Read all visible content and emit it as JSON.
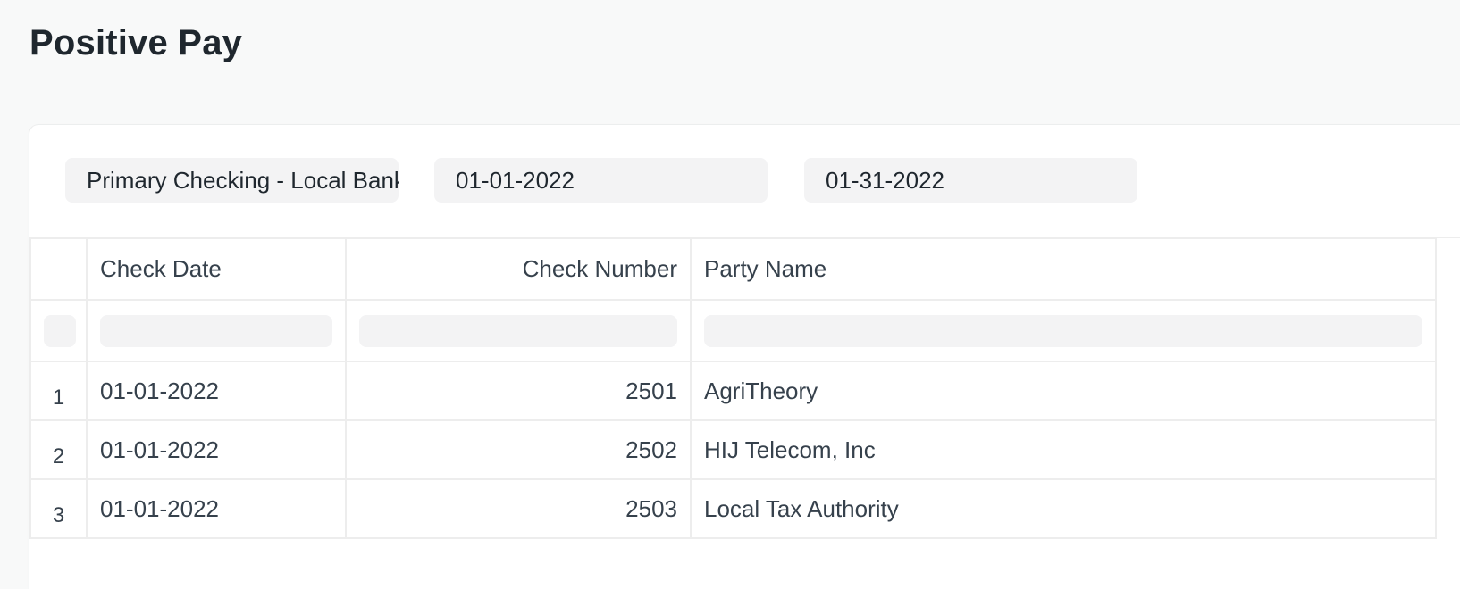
{
  "page": {
    "title": "Positive Pay"
  },
  "filters": {
    "account": "Primary Checking - Local Bank",
    "from_date": "01-01-2022",
    "to_date": "01-31-2022"
  },
  "table": {
    "columns": [
      "Check Date",
      "Check Number",
      "Party Name"
    ],
    "rows": [
      {
        "index": "1",
        "check_date": "01-01-2022",
        "check_number": "2501",
        "party_name": "AgriTheory"
      },
      {
        "index": "2",
        "check_date": "01-01-2022",
        "check_number": "2502",
        "party_name": "HIJ Telecom, Inc"
      },
      {
        "index": "3",
        "check_date": "01-01-2022",
        "check_number": "2503",
        "party_name": "Local Tax Authority"
      }
    ]
  }
}
